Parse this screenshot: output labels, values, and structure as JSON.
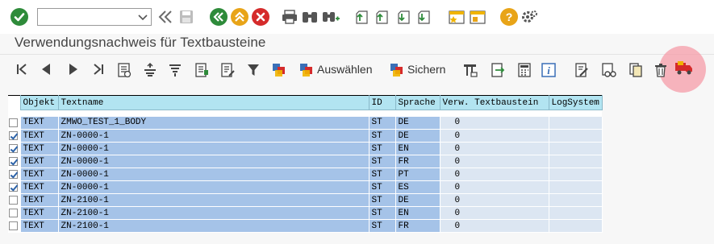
{
  "title": "Verwendungsnachweis für Textbausteine",
  "command_field": {
    "value": ""
  },
  "system_toolbar": {
    "icons": [
      "enter-icon",
      "back-icon",
      "save-icon",
      "nav-back-icon",
      "exit-icon",
      "cancel-icon",
      "print-icon",
      "find-icon",
      "find-next-icon",
      "first-page-icon",
      "previous-page-icon",
      "next-page-icon",
      "last-page-icon",
      "create-session-icon",
      "shortcut-icon",
      "help-icon",
      "customize-layout-icon"
    ]
  },
  "app_toolbar": {
    "select_label": "Auswählen",
    "save_label": "Sichern"
  },
  "colors": {
    "header_bg": "#b2e4f1",
    "key_cell_bg": "#a5c3e8",
    "value_cell_bg": "#dce6f2",
    "highlight": "#f69ca8"
  },
  "grid": {
    "columns": [
      "Objekt",
      "Textname",
      "ID",
      "Sprache",
      "Verw. Textbaustein",
      "LogSystem"
    ],
    "rows": [
      {
        "selected": false,
        "objekt": "TEXT",
        "textname": "ZMWO_TEST_1_BODY",
        "id": "ST",
        "sprache": "DE",
        "verw": "0",
        "logsystem": ""
      },
      {
        "selected": true,
        "objekt": "TEXT",
        "textname": "ZN-0000-1",
        "id": "ST",
        "sprache": "DE",
        "verw": "0",
        "logsystem": ""
      },
      {
        "selected": true,
        "objekt": "TEXT",
        "textname": "ZN-0000-1",
        "id": "ST",
        "sprache": "EN",
        "verw": "0",
        "logsystem": ""
      },
      {
        "selected": true,
        "objekt": "TEXT",
        "textname": "ZN-0000-1",
        "id": "ST",
        "sprache": "FR",
        "verw": "0",
        "logsystem": ""
      },
      {
        "selected": true,
        "objekt": "TEXT",
        "textname": "ZN-0000-1",
        "id": "ST",
        "sprache": "PT",
        "verw": "0",
        "logsystem": ""
      },
      {
        "selected": true,
        "objekt": "TEXT",
        "textname": "ZN-0000-1",
        "id": "ST",
        "sprache": "ES",
        "verw": "0",
        "logsystem": ""
      },
      {
        "selected": false,
        "objekt": "TEXT",
        "textname": "ZN-2100-1",
        "id": "ST",
        "sprache": "DE",
        "verw": "0",
        "logsystem": ""
      },
      {
        "selected": false,
        "objekt": "TEXT",
        "textname": "ZN-2100-1",
        "id": "ST",
        "sprache": "EN",
        "verw": "0",
        "logsystem": ""
      },
      {
        "selected": false,
        "objekt": "TEXT",
        "textname": "ZN-2100-1",
        "id": "ST",
        "sprache": "FR",
        "verw": "0",
        "logsystem": ""
      }
    ]
  }
}
